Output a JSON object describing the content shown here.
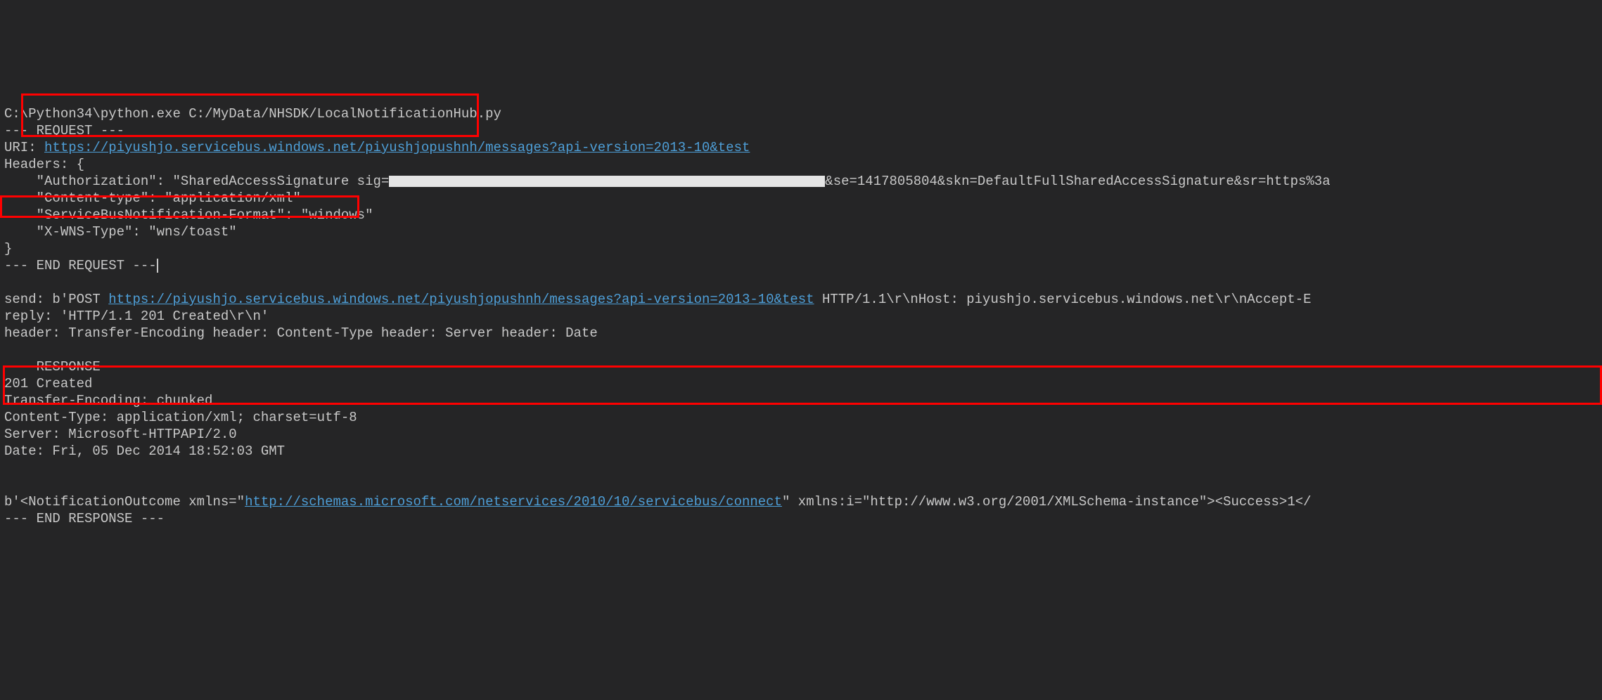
{
  "line1": "C:\\Python34\\python.exe C:/MyData/NHSDK/LocalNotificationHub.py",
  "line2": "--- REQUEST ---",
  "line3_pre": "URI: ",
  "line3_link": "https://piyushjo.servicebus.windows.net/piyushjopushnh/messages?api-version=2013-10&test",
  "line4": "Headers: {",
  "line5_a": "    \"Authorization\": \"SharedAccessSignature sig=",
  "line5_b": "&se=1417805804&skn=DefaultFullSharedAccessSignature&sr=https%3a",
  "line6": "    \"Content-type\": \"application/xml\"",
  "line7": "    \"ServiceBusNotification-Format\": \"windows\"",
  "line8": "    \"X-WNS-Type\": \"wns/toast\"",
  "line9": "}",
  "line10": "--- END REQUEST ---",
  "blank": " ",
  "line12_pre": "send: b'POST ",
  "line12_link": "https://piyushjo.servicebus.windows.net/piyushjopushnh/messages?api-version=2013-10&test",
  "line12_post": " HTTP/1.1\\r\\nHost: piyushjo.servicebus.windows.net\\r\\nAccept-E",
  "line13": "reply: 'HTTP/1.1 201 Created\\r\\n'",
  "line14": "header: Transfer-Encoding header: Content-Type header: Server header: Date",
  "line16": "--- RESPONSE ---",
  "line17": "201 Created",
  "line18": "Transfer-Encoding: chunked",
  "line19": "Content-Type: application/xml; charset=utf-8",
  "line20": "Server: Microsoft-HTTPAPI/2.0",
  "line21": "Date: Fri, 05 Dec 2014 18:52:03 GMT",
  "line23_a": "b'<NotificationOutcome xmlns=\"",
  "line23_link": "http://schemas.microsoft.com/netservices/2010/10/servicebus/connect",
  "line23_b": "\" xmlns:i=\"http://www.w3.org/2001/XMLSchema-instance\"><Success>1</",
  "line24": "--- END RESPONSE ---"
}
